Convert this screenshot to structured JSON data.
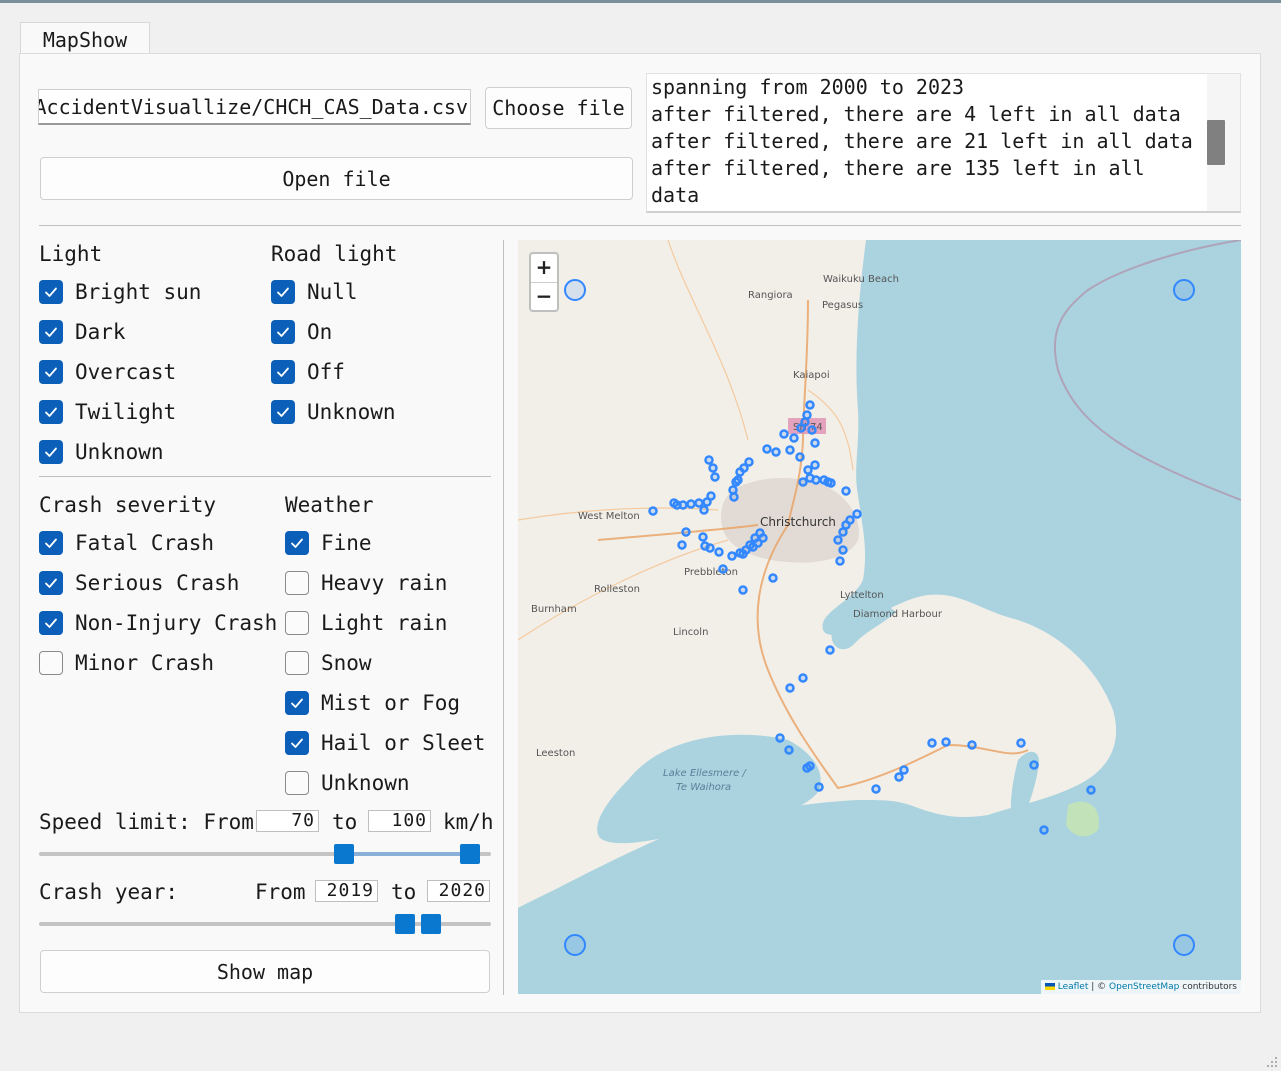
{
  "tab": {
    "label": "MapShow"
  },
  "file": {
    "path": "AccidentVisuallize/CHCH_CAS_Data.csv",
    "choose_label": "Choose file",
    "open_label": "Open file"
  },
  "log": {
    "text": "spanning from 2000 to 2023\nafter filtered, there are 4 left in all data\nafter filtered, there are 21 left in all data\nafter filtered, there are 135 left in all\ndata"
  },
  "light": {
    "title": "Light",
    "options": [
      {
        "label": "Bright sun",
        "checked": true
      },
      {
        "label": "Dark",
        "checked": true
      },
      {
        "label": "Overcast",
        "checked": true
      },
      {
        "label": "Twilight",
        "checked": true
      },
      {
        "label": "Unknown",
        "checked": true
      }
    ]
  },
  "road_light": {
    "title": "Road light",
    "options": [
      {
        "label": "Null",
        "checked": true
      },
      {
        "label": "On",
        "checked": true
      },
      {
        "label": "Off",
        "checked": true
      },
      {
        "label": "Unknown",
        "checked": true
      }
    ]
  },
  "severity": {
    "title": "Crash severity",
    "options": [
      {
        "label": "Fatal Crash",
        "checked": true
      },
      {
        "label": "Serious Crash",
        "checked": true
      },
      {
        "label": "Non-Injury Crash",
        "checked": true
      },
      {
        "label": "Minor Crash",
        "checked": false
      }
    ]
  },
  "weather": {
    "title": "Weather",
    "options": [
      {
        "label": "Fine",
        "checked": true
      },
      {
        "label": "Heavy rain",
        "checked": false
      },
      {
        "label": "Light rain",
        "checked": false
      },
      {
        "label": "Snow",
        "checked": false
      },
      {
        "label": "Mist or Fog",
        "checked": true
      },
      {
        "label": "Hail or Sleet",
        "checked": true
      },
      {
        "label": "Unknown",
        "checked": false
      }
    ]
  },
  "speed": {
    "label": "Speed limit: From",
    "from": "70",
    "to_label": "to",
    "to": "100",
    "unit": "km/h"
  },
  "year": {
    "label": "Crash year:",
    "from_label": "From",
    "from": "2019",
    "to_label": "to",
    "to": "2020"
  },
  "show_map": {
    "label": "Show map"
  },
  "map": {
    "zoom_in": "+",
    "zoom_out": "−",
    "places": [
      "Waikuku Beach",
      "Rangiora",
      "Pegasus",
      "Kaiapoi",
      "SH 74",
      "West Melton",
      "Christchurch",
      "Rolleston",
      "Prebbleton",
      "Burnham",
      "Lyttelton",
      "Diamond Harbour",
      "Lincoln",
      "Leeston",
      "Lake Ellesmere /",
      "Te Waihora"
    ],
    "attribution": {
      "leaflet": "Leaflet",
      "separator": " | © ",
      "osm": "OpenStreetMap",
      "suffix": " contributors"
    },
    "colors": {
      "water": "#aad3df",
      "land": "#f2efe9",
      "marker": "#3388ff"
    }
  }
}
